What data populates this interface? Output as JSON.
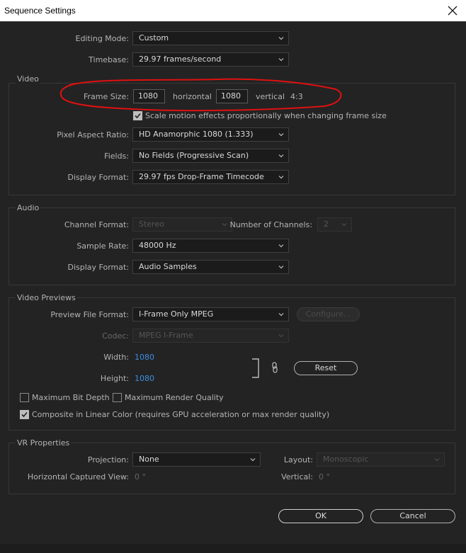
{
  "window": {
    "title": "Sequence Settings"
  },
  "top": {
    "editing_mode": {
      "label": "Editing Mode:",
      "value": "Custom"
    },
    "timebase": {
      "label": "Timebase:",
      "value": "29.97  frames/second"
    }
  },
  "video": {
    "title": "Video",
    "frame_size": {
      "label": "Frame Size:",
      "horizontal_value": "1080",
      "horizontal_label": "horizontal",
      "vertical_value": "1080",
      "vertical_label": "vertical",
      "aspect": "4:3"
    },
    "scale_motion": {
      "label": "Scale motion effects proportionally when changing frame size",
      "checked": true
    },
    "pixel_aspect": {
      "label": "Pixel Aspect Ratio:",
      "value": "HD Anamorphic 1080 (1.333)"
    },
    "fields": {
      "label": "Fields:",
      "value": "No Fields (Progressive Scan)"
    },
    "display_format": {
      "label": "Display Format:",
      "value": "29.97 fps Drop-Frame Timecode"
    }
  },
  "audio": {
    "title": "Audio",
    "channel_format": {
      "label": "Channel Format:",
      "value": "Stereo"
    },
    "num_channels": {
      "label": "Number of Channels:",
      "value": "2"
    },
    "sample_rate": {
      "label": "Sample Rate:",
      "value": "48000 Hz"
    },
    "display_format": {
      "label": "Display Format:",
      "value": "Audio Samples"
    }
  },
  "previews": {
    "title": "Video Previews",
    "file_format": {
      "label": "Preview File Format:",
      "value": "I-Frame Only MPEG"
    },
    "configure_label": "Configure...",
    "codec": {
      "label": "Codec:",
      "value": "MPEG I-Frame"
    },
    "width": {
      "label": "Width:",
      "value": "1080"
    },
    "height": {
      "label": "Height:",
      "value": "1080"
    },
    "reset_label": "Reset",
    "max_bit_depth": {
      "label": "Maximum Bit Depth",
      "checked": false
    },
    "max_render_quality": {
      "label": "Maximum Render Quality",
      "checked": false
    },
    "linear_color": {
      "label": "Composite in Linear Color (requires GPU acceleration or max render quality)",
      "checked": true
    }
  },
  "vr": {
    "title": "VR Properties",
    "projection": {
      "label": "Projection:",
      "value": "None"
    },
    "layout": {
      "label": "Layout:",
      "value": "Monoscopic"
    },
    "h_captured": {
      "label": "Horizontal Captured View:",
      "value": "0 °"
    },
    "vertical": {
      "label": "Vertical:",
      "value": "0 °"
    }
  },
  "buttons": {
    "ok": "OK",
    "cancel": "Cancel"
  },
  "annotation": {
    "color": "#e01010"
  },
  "colors": {
    "background": "#232323",
    "accent_blue": "#3c8ee0"
  }
}
